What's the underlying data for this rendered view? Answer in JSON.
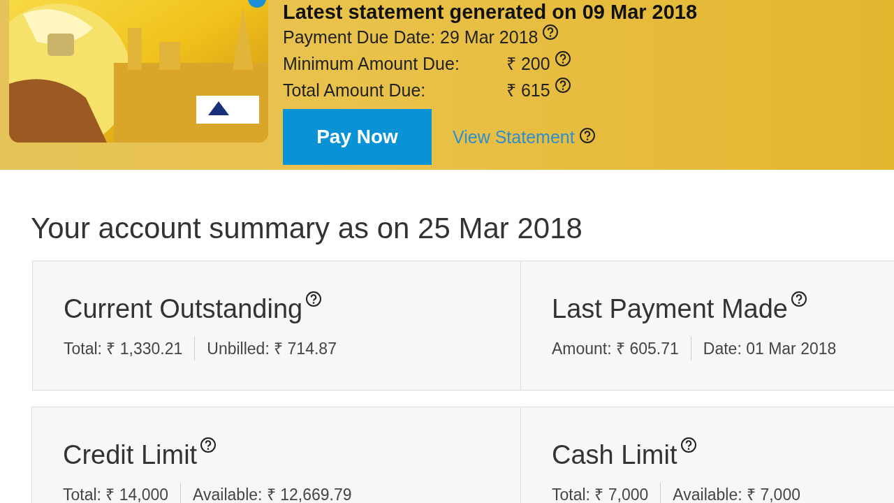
{
  "statement": {
    "heading": "Latest statement generated on 09 Mar 2018",
    "rows": [
      {
        "kind": "date",
        "text": "Payment Due Date: 29 Mar 2018"
      },
      {
        "kind": "amount",
        "label": "Minimum Amount Due:",
        "value": "₹ 200"
      },
      {
        "kind": "amount",
        "label": "Total Amount Due:",
        "value": "₹ 615"
      }
    ],
    "pay_button": "Pay Now",
    "view_link": "View Statement"
  },
  "summary": {
    "title": "Your account summary as on 25 Mar 2018",
    "cards": [
      {
        "title": "Current Outstanding",
        "items": [
          "Total: ₹ 1,330.21",
          "Unbilled: ₹ 714.87"
        ]
      },
      {
        "title": "Last Payment Made",
        "items": [
          "Amount: ₹ 605.71",
          "Date: 01 Mar 2018"
        ]
      },
      {
        "title": "Credit Limit",
        "items": [
          "Total: ₹ 14,000",
          "Available: ₹ 12,669.79"
        ]
      },
      {
        "title": "Cash Limit",
        "items": [
          "Total: ₹ 7,000",
          "Available: ₹ 7,000"
        ]
      }
    ]
  }
}
